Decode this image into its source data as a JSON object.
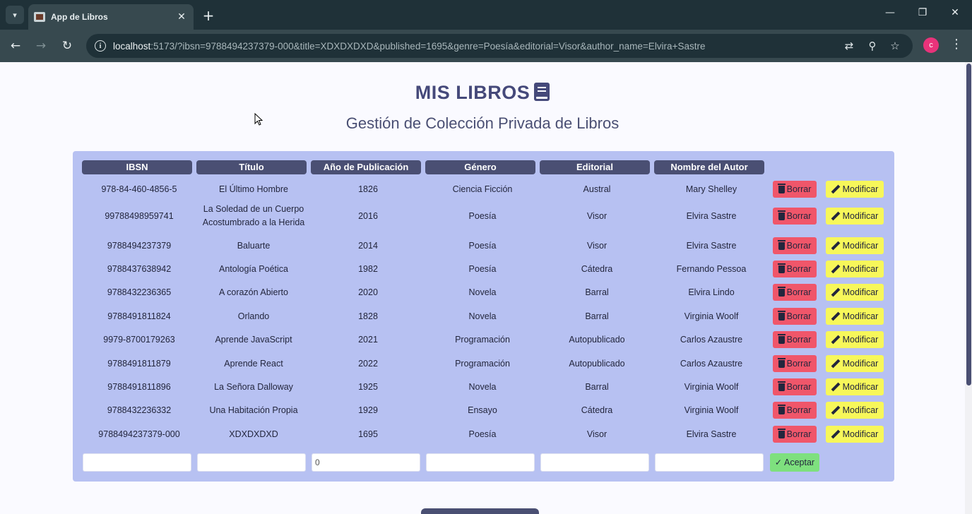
{
  "browser": {
    "tab_title": "App de Libros",
    "url_host": "localhost",
    "url_rest": ":5173/?ibsn=9788494237379-000&title=XDXDXDXD&published=1695&genre=Poesía&editorial=Visor&author_name=Elvira+Sastre",
    "profile_initial": "c"
  },
  "header": {
    "title": "MIS LIBROS",
    "subtitle": "Gestión de Colección Privada de Libros"
  },
  "table": {
    "columns": [
      "IBSN",
      "Título",
      "Año de Publicación",
      "Género",
      "Editorial",
      "Nombre del Autor"
    ],
    "delete_label": "Borrar",
    "modify_label": "Modificar",
    "rows": [
      [
        "978-84-460-4856-5",
        "El Último Hombre",
        "1826",
        "Ciencia Ficción",
        "Austral",
        "Mary Shelley"
      ],
      [
        "99788498959741",
        "La Soledad de un Cuerpo Acostumbrado a la Herida",
        "2016",
        "Poesía",
        "Visor",
        "Elvira Sastre"
      ],
      [
        "9788494237379",
        "Baluarte",
        "2014",
        "Poesía",
        "Visor",
        "Elvira Sastre"
      ],
      [
        "9788437638942",
        "Antología Poética",
        "1982",
        "Poesía",
        "Cátedra",
        "Fernando Pessoa"
      ],
      [
        "9788432236365",
        "A corazón Abierto",
        "2020",
        "Novela",
        "Barral",
        "Elvira Lindo"
      ],
      [
        "9788491811824",
        "Orlando",
        "1828",
        "Novela",
        "Barral",
        "Virginia Woolf"
      ],
      [
        "9979-8700179263",
        "Aprende JavaScript",
        "2021",
        "Programación",
        "Autopublicado",
        "Carlos Azaustre"
      ],
      [
        "9788491811879",
        "Aprende React",
        "2022",
        "Programación",
        "Autopublicado",
        "Carlos Azaustre"
      ],
      [
        "9788491811896",
        "La Señora Dalloway",
        "1925",
        "Novela",
        "Barral",
        "Virginia Woolf"
      ],
      [
        "9788432236332",
        "Una Habitación Propia",
        "1929",
        "Ensayo",
        "Cátedra",
        "Virginia Woolf"
      ],
      [
        "9788494237379-000",
        "XDXDXDXD",
        "1695",
        "Poesía",
        "Visor",
        "Elvira Sastre"
      ]
    ]
  },
  "form": {
    "ibsn_value": "",
    "title_value": "",
    "published_value": "0",
    "genre_value": "",
    "editorial_value": "",
    "author_value": "",
    "accept_label": "Aceptar"
  },
  "colors": {
    "accent": "#4a4f73",
    "panel": "#b7c1f2",
    "delete": "#f0566a",
    "modify": "#f7f75a",
    "accept": "#7ee07e"
  }
}
